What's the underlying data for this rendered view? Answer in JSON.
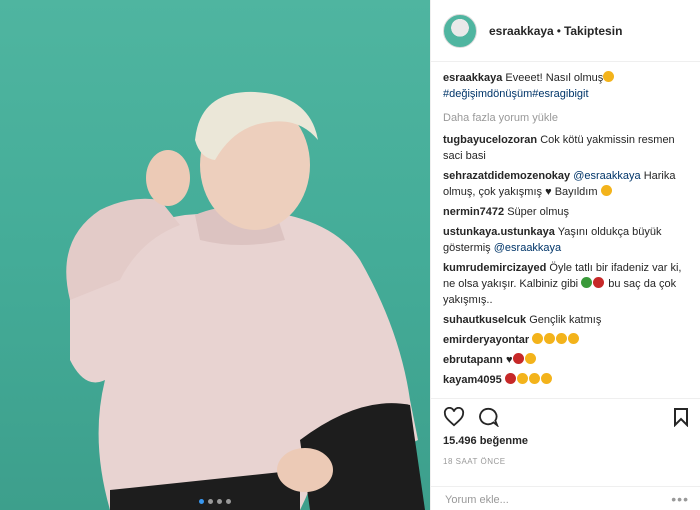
{
  "header": {
    "username": "esraakkaya",
    "separator": "•",
    "follow_status": "Takiptesin"
  },
  "caption": {
    "username": "esraakkaya",
    "text": "Eveeet! Nasıl olmuş",
    "hashtags": "#değişimdönüşüm#esragibigit"
  },
  "load_more": "Daha fazla yorum yükle",
  "comments": [
    {
      "user": "tugbayucelozoran",
      "text": "Cok kötü yakmissin resmen saci basi"
    },
    {
      "user": "sehrazatdidemozenokay",
      "mention": "@esraakkaya",
      "text": "Harika olmuş, çok yakışmış",
      "text2": "Bayıldım"
    },
    {
      "user": "nermin7472",
      "text": "Süper olmuş"
    },
    {
      "user": "ustunkaya.ustunkaya",
      "text": "Yaşını oldukça büyük göstermiş",
      "mention": "@esraakkaya"
    },
    {
      "user": "kumrudemircizayed",
      "text": "Öyle tatlı bir ifadeniz var ki, ne olsa yakışır. Kalbiniz gibi",
      "text2": "bu saç da çok yakışmış.."
    },
    {
      "user": "suhautkuselcuk",
      "text": "Gençlik katmış"
    },
    {
      "user": "emirderyayontar",
      "text": ""
    },
    {
      "user": "ebrutapann",
      "text": ""
    },
    {
      "user": "kayam4095",
      "text": ""
    }
  ],
  "likes": "15.496 beğenme",
  "time": "18 SAAT ÖNCE",
  "comment_input": {
    "placeholder": "Yorum ekle..."
  },
  "more_options": "•••",
  "icons": {
    "like": "heart-outline-icon",
    "comment": "comment-bubble-icon",
    "save": "bookmark-icon"
  },
  "colors": {
    "photo_bg": "#4fb5a0",
    "link": "#003569",
    "muted": "#999999"
  }
}
